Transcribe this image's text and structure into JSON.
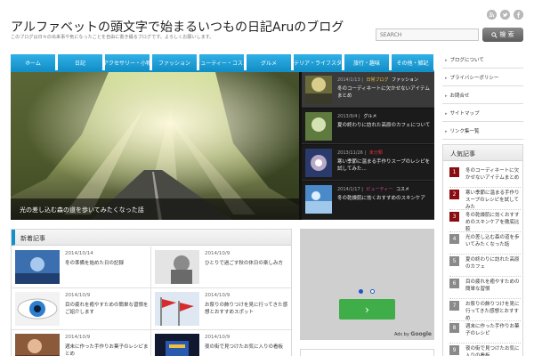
{
  "header": {
    "title": "アルファベットの頭文字で始まるいつもの日記Aruのブログ",
    "description": "このブログは日々の出来事や気になったことを自由に書き綴るブログです。よろしくお願いします。",
    "social_icons": [
      "rss-icon",
      "twitter-icon",
      "facebook-icon"
    ],
    "search_placeholder": "SEARCH",
    "search_button": "検 索"
  },
  "nav": {
    "items": [
      "ホーム",
      "日記",
      "アクセサリー・小物",
      "ファッション",
      "ビューティー・コスメ",
      "グルメ",
      "インテリア・ライフスタイル",
      "旅行・趣味",
      "その他・雑記"
    ]
  },
  "slider": {
    "main_caption": "光の差し込む森の道を歩いてみたくなった話",
    "items": [
      {
        "date": "2014/1/13",
        "category": "日常ブログ",
        "extra": "ファッション",
        "title": "冬のコーディネートに欠かせないアイテムまとめ"
      },
      {
        "date": "2013/9/4",
        "category": "グルメ",
        "title": "夏の終わりに訪れた高原のカフェについて"
      },
      {
        "date": "2013/11/26",
        "category": "未分類",
        "title": "寒い季節に温まる手作りスープのレシピを試してみた…"
      },
      {
        "date": "2014/1/17",
        "category": "ビューティー",
        "extra": "コスメ",
        "title": "冬の乾燥肌に効くおすすめのスキンケア"
      }
    ]
  },
  "newposts": {
    "heading": "新着記事",
    "posts": [
      {
        "date": "2014/10/14",
        "title": "冬の準備を始めた日の記録"
      },
      {
        "date": "2014/10/9",
        "title": "ひとりで過ごす秋の休日の楽しみ方"
      },
      {
        "date": "2014/10/9",
        "title": "目の疲れを癒やすための簡単な習慣をご紹介します"
      },
      {
        "date": "2014/10/9",
        "title": "お祭りの飾りつけを見に行ってきた感想とおすすめスポット"
      },
      {
        "date": "2014/10/9",
        "title": "週末に作った手作りお菓子のレシピまとめ"
      },
      {
        "date": "2014/10/9",
        "title": "夜の街で見つけたお気に入りの看板"
      }
    ]
  },
  "ad": {
    "ads_by": "Ads by",
    "brand": "Google",
    "next_glyph": "›"
  },
  "sidebar": {
    "links": [
      "ブログについて",
      "プライバシーポリシー",
      "お問合せ",
      "サイトマップ",
      "リンク集一覧"
    ],
    "ranking_heading": "人気記事",
    "ranking": [
      {
        "rank": "1",
        "title": "冬のコーディネートに欠かせないアイテムまとめ"
      },
      {
        "rank": "2",
        "title": "寒い季節に温まる手作りスープのレシピを試してみた"
      },
      {
        "rank": "3",
        "title": "冬の乾燥肌に効くおすすめのスキンケアを徹底比較"
      },
      {
        "rank": "4",
        "title": "光の差し込む森の道を歩いてみたくなった話"
      },
      {
        "rank": "5",
        "title": "夏の終わりに訪れた高原のカフェ"
      },
      {
        "rank": "6",
        "title": "目の疲れを癒やすための簡単な習慣"
      },
      {
        "rank": "7",
        "title": "お祭りの飾りつけを見に行ってきた感想とおすすめ"
      },
      {
        "rank": "8",
        "title": "週末に作った手作りお菓子のレシピ"
      },
      {
        "rank": "9",
        "title": "夜の街で見つけたお気に入りの看板"
      }
    ],
    "rank_colors": {
      "top": "#8b0d12",
      "other": "#8a8a8a"
    }
  },
  "colors": {
    "nav_accent": "#1490c8",
    "category_yellow": "#e8c23a",
    "category_red": "#e0353a",
    "category_pink": "#e44aa8",
    "ad_button": "#3fae49"
  }
}
